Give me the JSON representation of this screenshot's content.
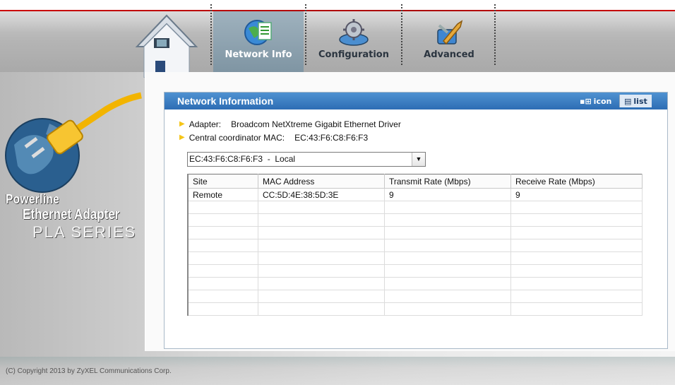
{
  "tabs": [
    {
      "label": "Network Info",
      "icon": "network-globe-icon",
      "active": true
    },
    {
      "label": "Configuration",
      "icon": "configuration-gear-icon",
      "active": false
    },
    {
      "label": "Advanced",
      "icon": "advanced-wrench-icon",
      "active": false
    }
  ],
  "sidebar": {
    "line1": "Powerline",
    "line2": "Ethernet Adapter",
    "line3": "PLA SERIES"
  },
  "copyright": "(C) Copyright 2013 by ZyXEL Communications Corp.",
  "panel": {
    "title": "Network Information",
    "view_icon_label": "icon",
    "view_list_label": "list"
  },
  "info": {
    "adapter_label": "Adapter:",
    "adapter_value": "Broadcom NetXtreme Gigabit Ethernet Driver",
    "coordinator_label": "Central coordinator MAC:",
    "coordinator_value": "EC:43:F6:C8:F6:F3"
  },
  "device_select": {
    "value": "EC:43:F6:C8:F6:F3  -  Local"
  },
  "table": {
    "columns": [
      "Site",
      "MAC Address",
      "Transmit Rate (Mbps)",
      "Receive Rate (Mbps)"
    ],
    "rows": [
      [
        "Remote",
        "CC:5D:4E:38:5D:3E",
        "9",
        "9"
      ],
      [
        "",
        "",
        "",
        ""
      ],
      [
        "",
        "",
        "",
        ""
      ],
      [
        "",
        "",
        "",
        ""
      ],
      [
        "",
        "",
        "",
        ""
      ],
      [
        "",
        "",
        "",
        ""
      ],
      [
        "",
        "",
        "",
        ""
      ],
      [
        "",
        "",
        "",
        ""
      ],
      [
        "",
        "",
        "",
        ""
      ],
      [
        "",
        "",
        "",
        ""
      ]
    ]
  },
  "colors": {
    "title_bar": "#2d6db4",
    "active_tab": "#8ea3b1",
    "bullet": "#f5c518"
  }
}
